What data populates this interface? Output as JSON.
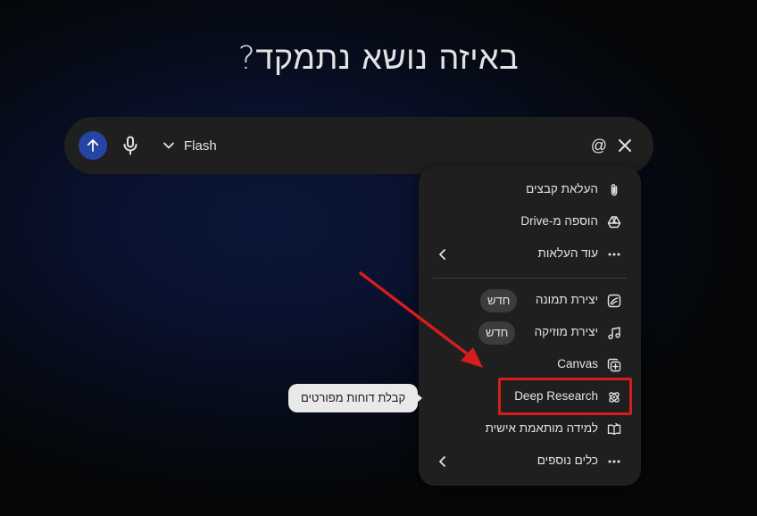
{
  "page": {
    "title": "באיזה נושא נתמקד?"
  },
  "composer": {
    "model_label": "Flash",
    "at_symbol": "@",
    "send_icon": "arrow-up-icon",
    "mic_icon": "mic-icon",
    "close_icon": "close-icon",
    "accent_color": "#2544a3"
  },
  "menu": {
    "upload_section": [
      {
        "label": "העלאת קבצים",
        "icon": "paperclip-icon"
      },
      {
        "label": "הוספה מ-Drive",
        "icon": "drive-icon"
      },
      {
        "label": "עוד העלאות",
        "icon": "more-icon",
        "has_submenu": true
      }
    ],
    "tools_section": [
      {
        "label": "יצירת תמונה",
        "icon": "image-gen-icon",
        "badge": "חדש"
      },
      {
        "label": "יצירת מוזיקה",
        "icon": "music-icon",
        "badge": "חדש"
      },
      {
        "label": "Canvas",
        "icon": "canvas-icon"
      },
      {
        "label": "Deep Research",
        "icon": "deep-research-icon",
        "highlighted": true
      },
      {
        "label": "למידה מותאמת אישית",
        "icon": "book-icon"
      },
      {
        "label": "כלים נוספים",
        "icon": "more-icon",
        "has_submenu": true
      }
    ]
  },
  "tooltip": {
    "text": "קבלת דוחות מפורטים"
  },
  "annotation": {
    "box_color": "#d51d1d",
    "arrow_color": "#d51d1d"
  }
}
